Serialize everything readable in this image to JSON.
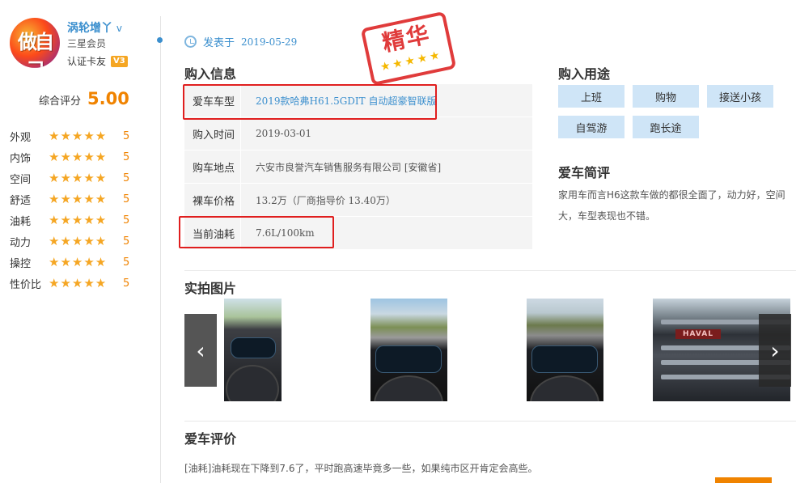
{
  "user": {
    "name": "涡轮增丫",
    "name_suffix": "v",
    "avatar_text": "做自己",
    "level": "三星会员",
    "verify": "认证卡友",
    "verify_badge": "V3"
  },
  "overall": {
    "label": "综合评分",
    "value": "5.00"
  },
  "ratings": [
    {
      "label": "外观",
      "stars": "★★★★★",
      "value": "5"
    },
    {
      "label": "内饰",
      "stars": "★★★★★",
      "value": "5"
    },
    {
      "label": "空间",
      "stars": "★★★★★",
      "value": "5"
    },
    {
      "label": "舒适",
      "stars": "★★★★★",
      "value": "5"
    },
    {
      "label": "油耗",
      "stars": "★★★★★",
      "value": "5"
    },
    {
      "label": "动力",
      "stars": "★★★★★",
      "value": "5"
    },
    {
      "label": "操控",
      "stars": "★★★★★",
      "value": "5"
    },
    {
      "label": "性价比",
      "stars": "★★★★★",
      "value": "5"
    }
  ],
  "post": {
    "label": "发表于",
    "date": "2019-05-29"
  },
  "stamp": {
    "text": "精华",
    "stars": "★★★★★"
  },
  "purchase_info": {
    "title": "购入信息",
    "rows": [
      {
        "key": "爱车车型",
        "value": "2019款哈弗H61.5GDIT 自动超豪智联版"
      },
      {
        "key": "购入时间",
        "value": "2019-03-01"
      },
      {
        "key": "购车地点",
        "value": "六安市良誉汽车销售服务有限公司 [安徽省]"
      },
      {
        "key": "裸车价格",
        "value": "13.2万（厂商指导价 13.40万）"
      },
      {
        "key": "当前油耗",
        "value": "7.6L/100km"
      }
    ]
  },
  "purpose": {
    "title": "购入用途",
    "tags": [
      "上班",
      "购物",
      "接送小孩",
      "自驾游",
      "跑长途"
    ]
  },
  "brief_review": {
    "title": "爱车简评",
    "text": "家用车而言H6这款车做的都很全面了，动力好，空间大，车型表现也不错。"
  },
  "photos": {
    "title": "实拍图片",
    "prev": "‹",
    "next": "›",
    "badge": "HAVAL"
  },
  "evaluation": {
    "title": "爱车评价",
    "comment": "[油耗]油耗现在下降到7.6了，平时跑高速毕竟多一些，如果纯市区开肯定会高些。"
  },
  "colors": {
    "accent_blue": "#3b8fce",
    "score_orange": "#f08300",
    "highlight_red": "#e01e1e",
    "tag_bg": "#cfe5f7"
  }
}
